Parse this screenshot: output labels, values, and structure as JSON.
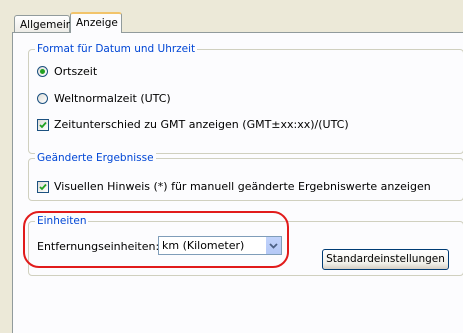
{
  "tabs": [
    {
      "label": "Allgemein",
      "active": false
    },
    {
      "label": "Anzeige",
      "active": true
    }
  ],
  "datetime_group": {
    "legend": "Format für Datum und Uhrzeit",
    "radio_local": {
      "label": "Ortszeit",
      "selected": true
    },
    "radio_utc": {
      "label": "Weltnormalzeit (UTC)",
      "selected": false
    },
    "gmt_checkbox": {
      "label": "Zeitunterschied zu GMT anzeigen (GMT±xx:xx)/(UTC)",
      "checked": true
    }
  },
  "changed_group": {
    "legend": "Geänderte Ergebnisse",
    "hint_checkbox": {
      "label": "Visuellen Hinweis (*) für manuell geänderte Ergebniswerte anzeigen",
      "checked": true
    }
  },
  "units_group": {
    "legend": "Einheiten",
    "distance_label": "Entfernungseinheiten:",
    "distance_value": "km (Kilometer)",
    "defaults_button": "Standardeinstellungen"
  },
  "colors": {
    "legend_text": "#0046d5",
    "highlight": "#e11b1b",
    "radio_dot": "#21a121",
    "check_mark": "#21a121"
  }
}
